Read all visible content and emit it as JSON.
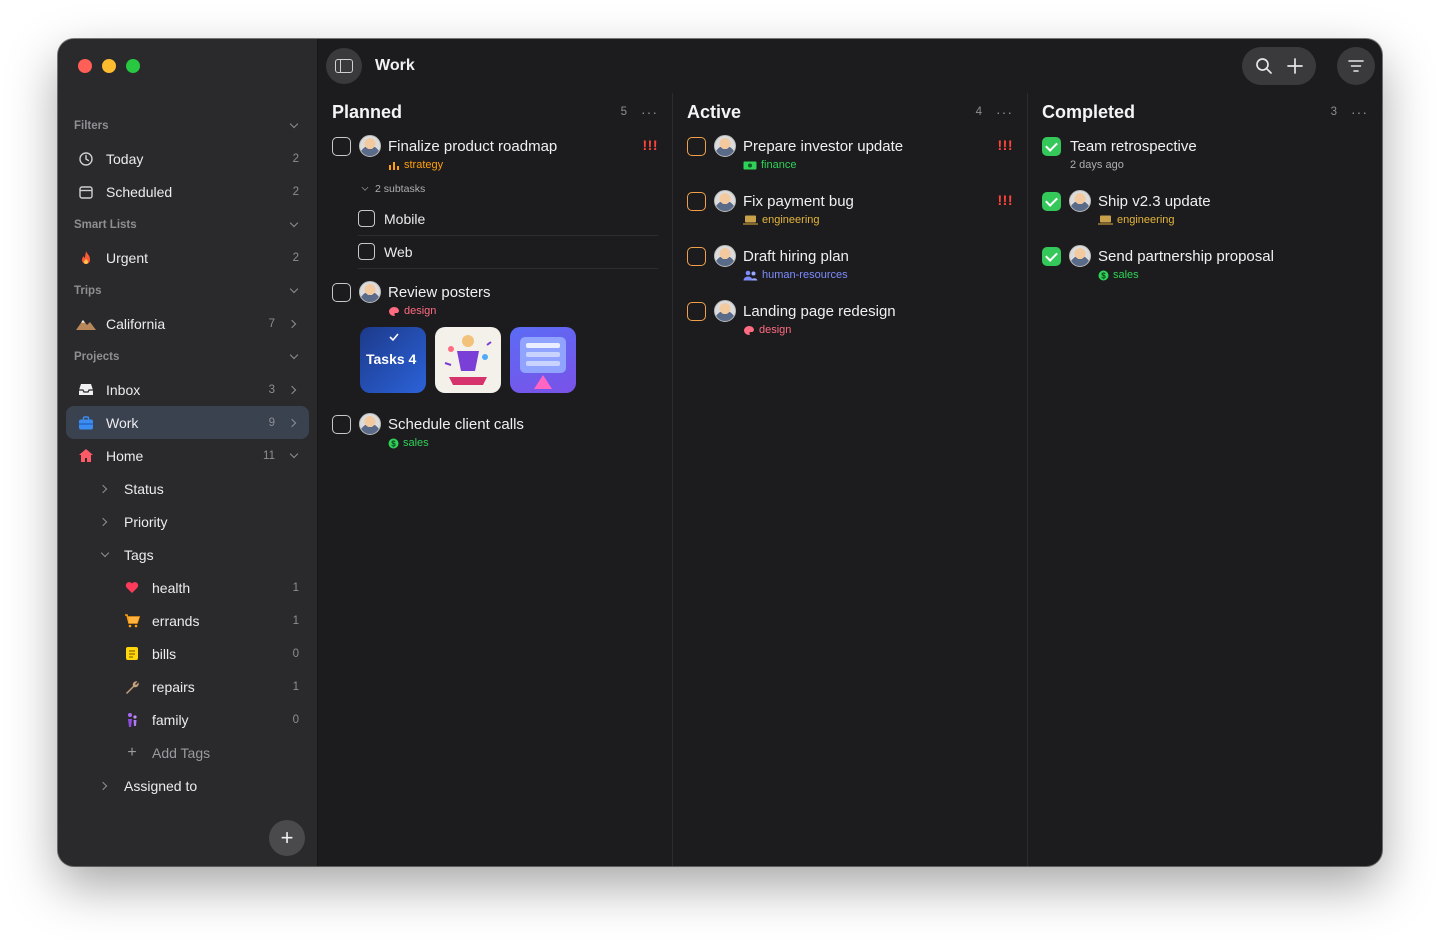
{
  "window": {
    "title": "Work"
  },
  "sidebar": {
    "sections": {
      "filters": "Filters",
      "smart_lists": "Smart Lists",
      "trips": "Trips",
      "projects": "Projects"
    },
    "filters": [
      {
        "label": "Today",
        "count": "2",
        "icon": "clock-icon"
      },
      {
        "label": "Scheduled",
        "count": "2",
        "icon": "calendar-icon"
      }
    ],
    "smart_lists": [
      {
        "label": "Urgent",
        "count": "2",
        "icon": "fire-icon"
      }
    ],
    "trips": [
      {
        "label": "California",
        "count": "7",
        "icon": "mountain-icon"
      }
    ],
    "projects": [
      {
        "label": "Inbox",
        "count": "3",
        "icon": "inbox-icon"
      },
      {
        "label": "Work",
        "count": "9",
        "icon": "briefcase-icon"
      },
      {
        "label": "Home",
        "count": "11",
        "icon": "house-icon"
      }
    ],
    "home_children": {
      "status": "Status",
      "priority": "Priority",
      "tags": "Tags",
      "assigned": "Assigned to"
    },
    "tags": [
      {
        "label": "health",
        "count": "1",
        "icon": "heart-icon"
      },
      {
        "label": "errands",
        "count": "1",
        "icon": "cart-icon"
      },
      {
        "label": "bills",
        "count": "0",
        "icon": "ledger-icon"
      },
      {
        "label": "repairs",
        "count": "1",
        "icon": "wrench-icon"
      },
      {
        "label": "family",
        "count": "0",
        "icon": "family-icon"
      }
    ],
    "add_tags": "Add Tags"
  },
  "columns": {
    "planned": {
      "title": "Planned",
      "count": "5",
      "tasks": [
        {
          "title": "Finalize product roadmap",
          "tag": "strategy",
          "priority": "!!!",
          "subtasks_label": "2 subtasks",
          "subtasks": [
            "Mobile",
            "Web"
          ]
        },
        {
          "title": "Review posters",
          "tag": "design",
          "thumb_label": "Tasks 4"
        },
        {
          "title": "Schedule client calls",
          "tag": "sales"
        }
      ]
    },
    "active": {
      "title": "Active",
      "count": "4",
      "tasks": [
        {
          "title": "Prepare investor update",
          "tag": "finance",
          "priority": "!!!"
        },
        {
          "title": "Fix payment bug",
          "tag": "engineering",
          "priority": "!!!"
        },
        {
          "title": "Draft hiring plan",
          "tag": "human-resources"
        },
        {
          "title": "Landing page redesign",
          "tag": "design"
        }
      ]
    },
    "completed": {
      "title": "Completed",
      "count": "3",
      "tasks": [
        {
          "title": "Team retrospective",
          "meta": "2 days ago"
        },
        {
          "title": "Ship v2.3 update",
          "tag": "engineering"
        },
        {
          "title": "Send partnership proposal",
          "tag": "sales"
        }
      ]
    }
  },
  "colors": {
    "accent_selected": "#3a4250",
    "priority": "#ff453a",
    "done": "#34c759",
    "active_checkbox": "#f0a04b"
  }
}
